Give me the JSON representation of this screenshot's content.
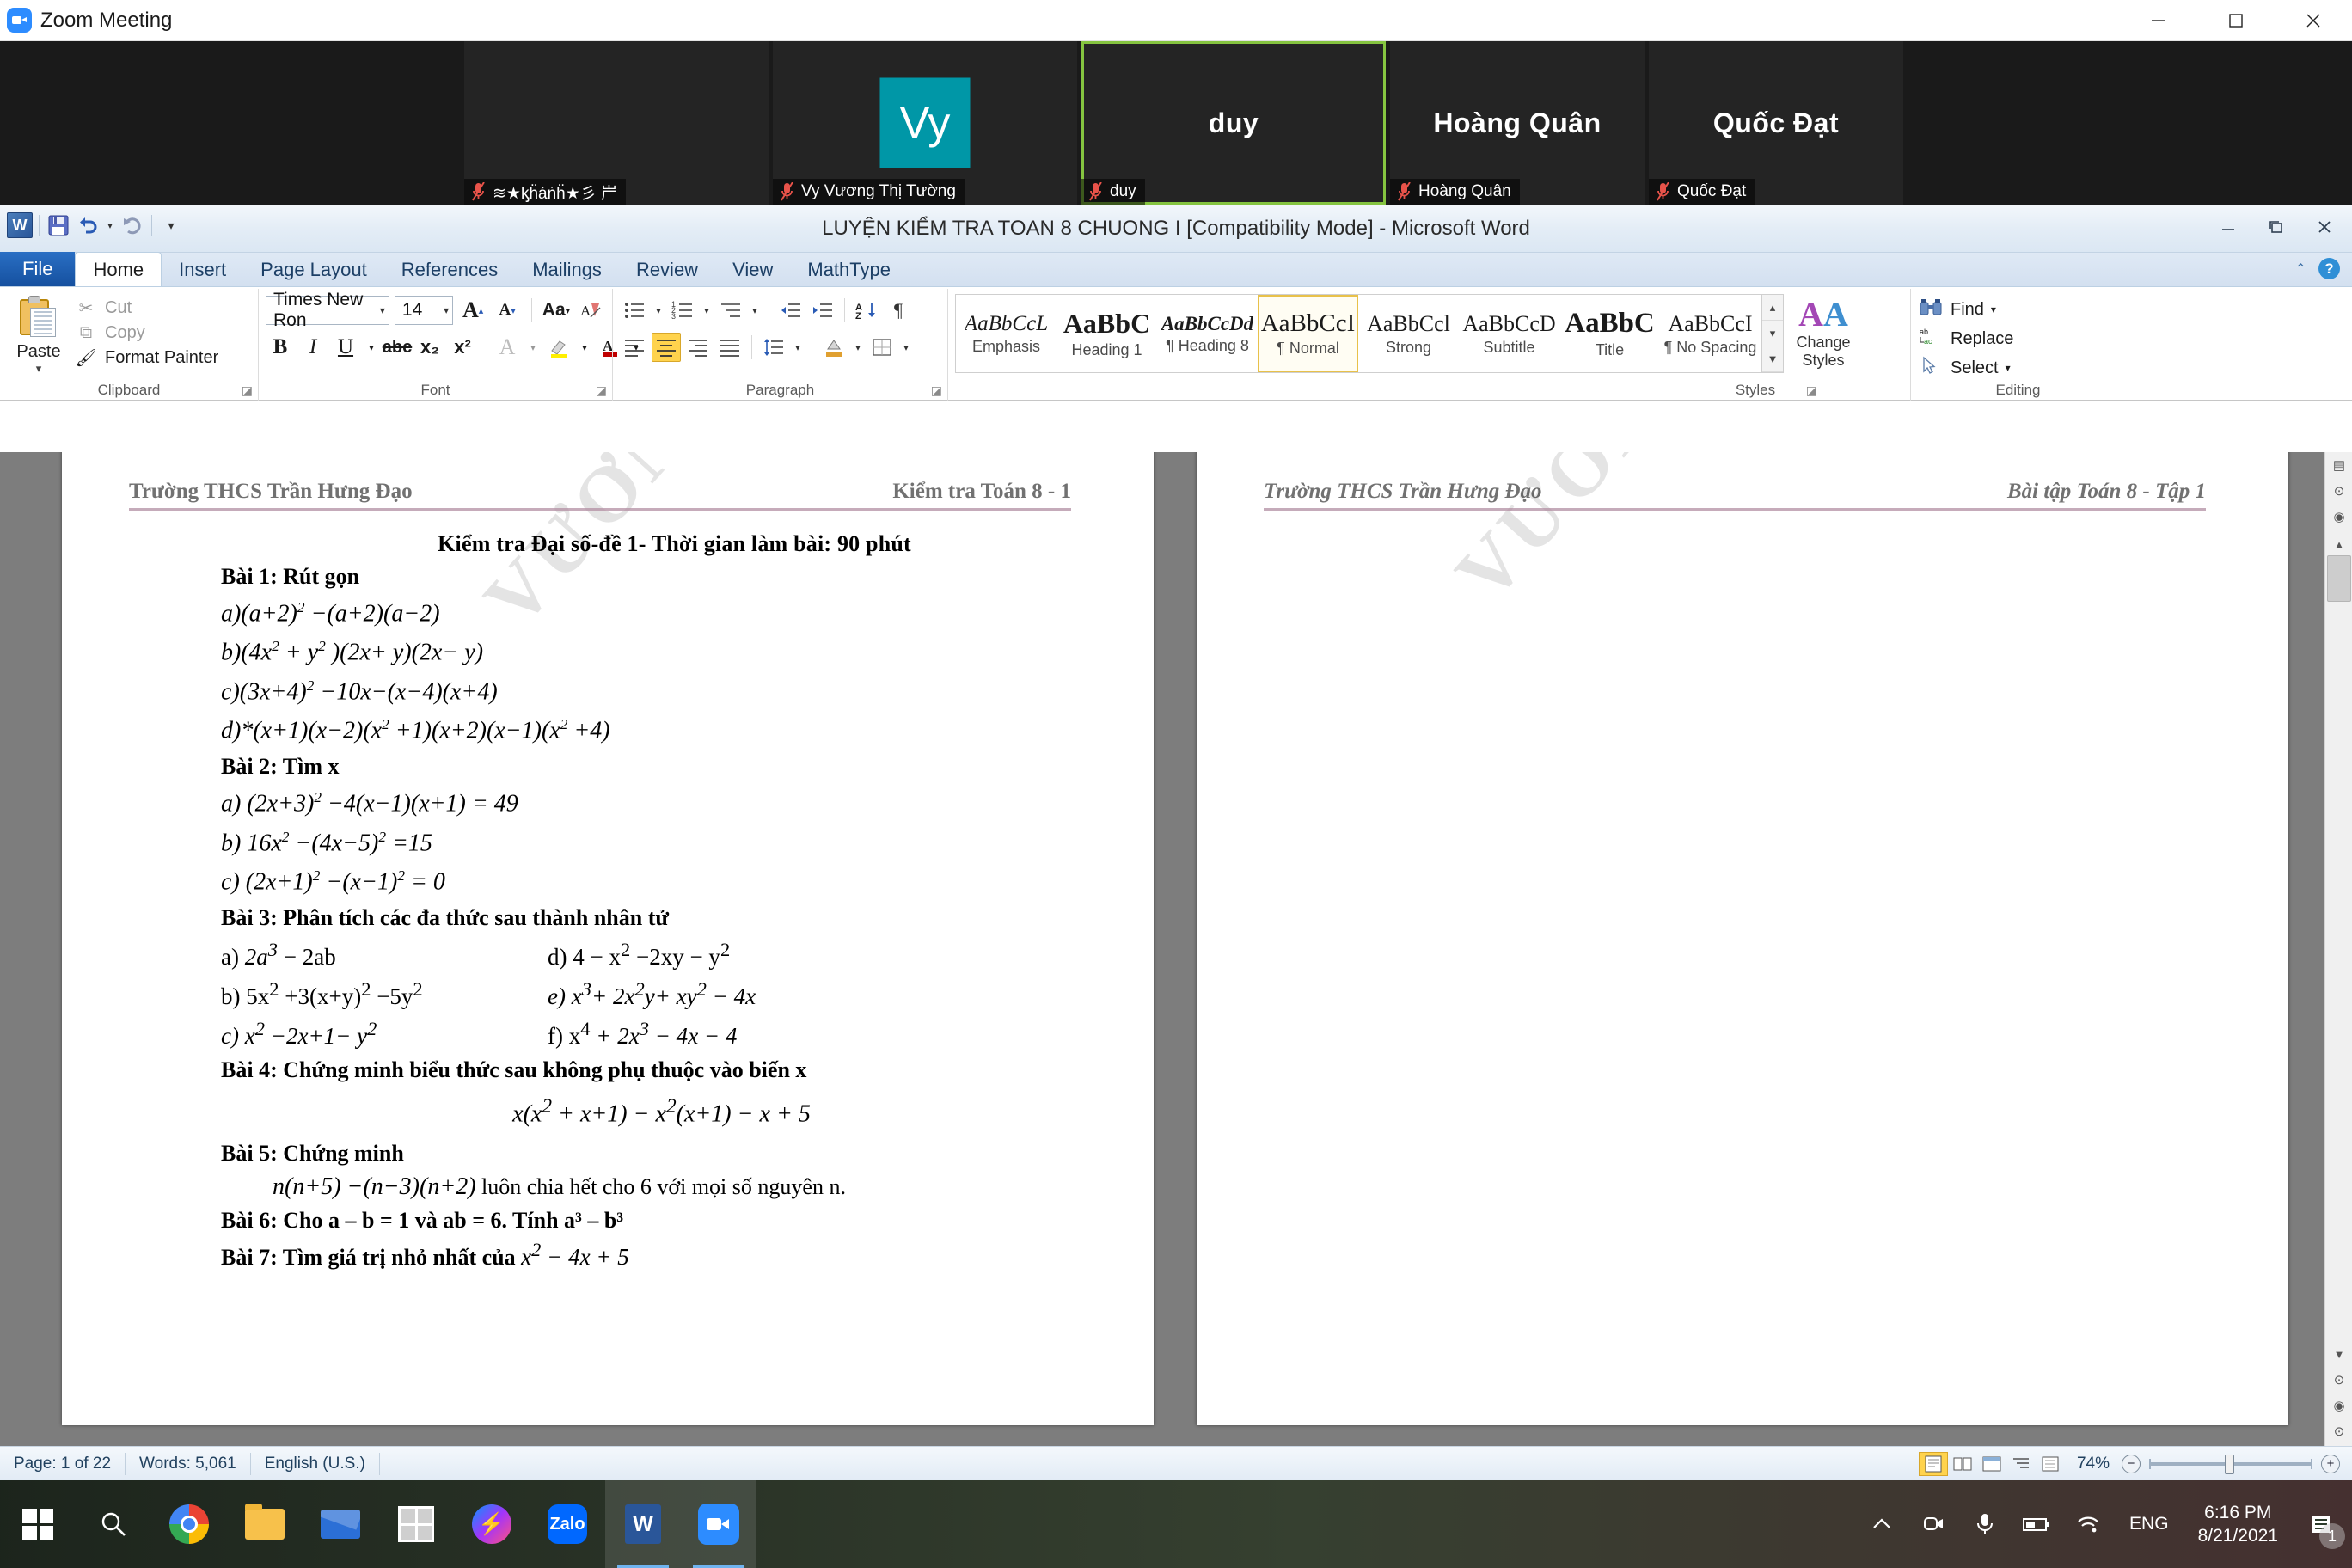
{
  "zoom_window": {
    "title": "Zoom Meeting",
    "window_controls": {
      "minimize": "minimize",
      "maximize": "maximize",
      "close": "close"
    },
    "participants": [
      {
        "display_name": "",
        "label": "≋★ᶄḧáṅḧ★彡 屵",
        "avatar_text": "",
        "selected": false,
        "muted": true,
        "has_avatar": false
      },
      {
        "display_name": "",
        "label": "Vy Vương Thị Tường",
        "avatar_text": "Vy",
        "selected": false,
        "muted": true,
        "has_avatar": true
      },
      {
        "display_name": "duy",
        "label": "duy",
        "avatar_text": "",
        "selected": true,
        "muted": true,
        "has_avatar": false
      },
      {
        "display_name": "Hoàng Quân",
        "label": "Hoàng Quân",
        "avatar_text": "",
        "selected": false,
        "muted": true,
        "has_avatar": false
      },
      {
        "display_name": "Quốc Đạt",
        "label": "Quốc Đạt",
        "avatar_text": "",
        "selected": false,
        "muted": true,
        "has_avatar": false
      }
    ]
  },
  "word": {
    "title": "LUYỆN KIỂM TRA TOAN 8 CHUONG I [Compatibility Mode]  -  Microsoft Word",
    "quick_access": [
      "word-logo",
      "save-icon",
      "undo-icon",
      "redo-icon",
      "customize-icon"
    ],
    "tabs": [
      {
        "label": "File",
        "kind": "file"
      },
      {
        "label": "Home",
        "kind": "active"
      },
      {
        "label": "Insert",
        "kind": "normal"
      },
      {
        "label": "Page Layout",
        "kind": "normal"
      },
      {
        "label": "References",
        "kind": "normal"
      },
      {
        "label": "Mailings",
        "kind": "normal"
      },
      {
        "label": "Review",
        "kind": "normal"
      },
      {
        "label": "View",
        "kind": "normal"
      },
      {
        "label": "MathType",
        "kind": "normal"
      }
    ],
    "clipboard": {
      "group_label": "Clipboard",
      "paste_label": "Paste",
      "cut_label": "Cut",
      "copy_label": "Copy",
      "format_painter_label": "Format Painter"
    },
    "font": {
      "group_label": "Font",
      "font_name": "Times New Ron",
      "font_size": "14",
      "grow_font": "A",
      "shrink_font": "A",
      "change_case": "Aa",
      "clear_formatting": "clear-formatting-icon",
      "bold": "B",
      "italic": "I",
      "underline": "U",
      "strikethrough": "abc",
      "subscript": "x₂",
      "superscript": "x²",
      "text_effects": "A",
      "highlight": "highlight-icon",
      "font_color": "A"
    },
    "paragraph": {
      "group_label": "Paragraph",
      "buttons": [
        "bullets",
        "numbering",
        "multilevel-list",
        "decrease-indent",
        "increase-indent",
        "sort",
        "show-marks",
        "align-left",
        "align-center",
        "align-right",
        "justify",
        "line-spacing",
        "shading",
        "borders"
      ],
      "show_marks_glyph": "¶",
      "sort_glyph": "A↓"
    },
    "styles": {
      "group_label": "Styles",
      "items": [
        {
          "preview": "AaBbCcL",
          "name": "Emphasis",
          "selected": false
        },
        {
          "preview": "AaBbC",
          "name": "Heading 1",
          "selected": false
        },
        {
          "preview": "AaBbCcDd",
          "name": "¶ Heading 8",
          "selected": false
        },
        {
          "preview": "AaBbCcI",
          "name": "¶ Normal",
          "selected": true
        },
        {
          "preview": "AaBbCcl",
          "name": "Strong",
          "selected": false
        },
        {
          "preview": "AaBbCcD",
          "name": "Subtitle",
          "selected": false
        },
        {
          "preview": "AaBbC",
          "name": "Title",
          "selected": false
        },
        {
          "preview": "AaBbCcI",
          "name": "¶ No Spacing",
          "selected": false
        }
      ],
      "change_styles_label": "Change Styles"
    },
    "editing": {
      "group_label": "Editing",
      "find_label": "Find",
      "replace_label": "Replace",
      "select_label": "Select"
    },
    "window_controls": {
      "minimize": "minimize",
      "restore": "restore",
      "close": "close"
    },
    "status_bar": {
      "page": "Page: 1 of 22",
      "words": "Words: 5,061",
      "language": "English (U.S.)",
      "zoom": "74%",
      "zoom_out": "−",
      "zoom_in": "+",
      "view_buttons": [
        "print-layout",
        "full-screen-reading",
        "web-layout",
        "outline",
        "draft"
      ]
    }
  },
  "document": {
    "page1_header_left": "Trường THCS Trần Hưng Đạo",
    "page1_header_right": "Kiểm tra Toán 8 - 1",
    "page2_header_left": "Trường THCS Trần Hưng Đạo",
    "page2_header_right": "Bài tập Toán 8 - Tập 1",
    "watermark": "VƯƠNG THỊ TƯỜNG VY",
    "title": "Kiểm tra Đại số-đề 1- Thời gian làm bài: 90 phút",
    "bai1": {
      "heading": "Bài 1: Rút gọn",
      "items": [
        "a)(a+2)² −(a+2)(a−2)",
        "b)(4x² + y²)(2x+ y)(2x− y)",
        "c)(3x+4)² −10x−(x−4)(x+4)",
        "d)*(x+1)(x−2)(x² +1)(x+2)(x−1)(x² +4)"
      ]
    },
    "bai2": {
      "heading": "Bài 2: Tìm x",
      "items": [
        "a) (2x+3)² −4(x−1)(x+1) = 49",
        "b) 16x² −(4x−5)² =15",
        "c) (2x+1)² −(x−1)² = 0"
      ]
    },
    "bai3": {
      "heading": "Bài 3:  Phân tích các đa thức sau thành nhân tử",
      "left": [
        "a) 2a³ − 2ab",
        "b) 5x² +3(x+y)² −5y²",
        "c) x² −2x+1− y²"
      ],
      "right": [
        "d) 4 − x² −2xy − y²",
        "e) x³ + 2x²y + xy² − 4x",
        "f) x⁴ + 2x³ − 4x − 4"
      ]
    },
    "bai4": {
      "heading": "Bài 4: Chứng minh biểu thức sau không phụ thuộc vào biến x",
      "expression": "x(x² + x+1) − x²(x+1) − x + 5"
    },
    "bai5": {
      "heading": "Bài 5: Chứng minh",
      "expression": "n(n+5) −(n−3)(n+2)",
      "tail": " luôn chia hết cho 6 với mọi số nguyên n."
    },
    "bai6": "Bài 6: Cho a – b = 1 và ab = 6. Tính  a³ – b³",
    "bai7_label": "Bài 7: Tìm giá trị nhỏ nhất của ",
    "bai7_expr": "x² − 4x + 5"
  },
  "taskbar": {
    "start": "windows-start-icon",
    "items": [
      {
        "name": "search-icon",
        "active": false
      },
      {
        "name": "chrome-icon",
        "active": false
      },
      {
        "name": "file-explorer-icon",
        "active": false
      },
      {
        "name": "mail-icon",
        "active": false
      },
      {
        "name": "microsoft-store-icon",
        "active": false
      },
      {
        "name": "messenger-icon",
        "active": false
      },
      {
        "name": "zalo-icon",
        "active": false
      },
      {
        "name": "word-icon",
        "active": true
      },
      {
        "name": "zoom-icon",
        "active": true
      }
    ],
    "tray": {
      "show_hidden": "^",
      "icons": [
        "zoom-tray-icon",
        "microphone-icon",
        "battery-icon",
        "wifi-icon"
      ],
      "language": "ENG",
      "time": "6:16 PM",
      "date": "8/21/2021",
      "notification_count": "1"
    }
  },
  "colors": {
    "zoom_blue": "#2d8cff",
    "selected_tile_border": "#85c440",
    "mic_off_red": "#e8534a",
    "avatar_teal": "#0097a7",
    "ribbon_highlight": "#ffd34d",
    "style_selected": "#e8c14a"
  }
}
